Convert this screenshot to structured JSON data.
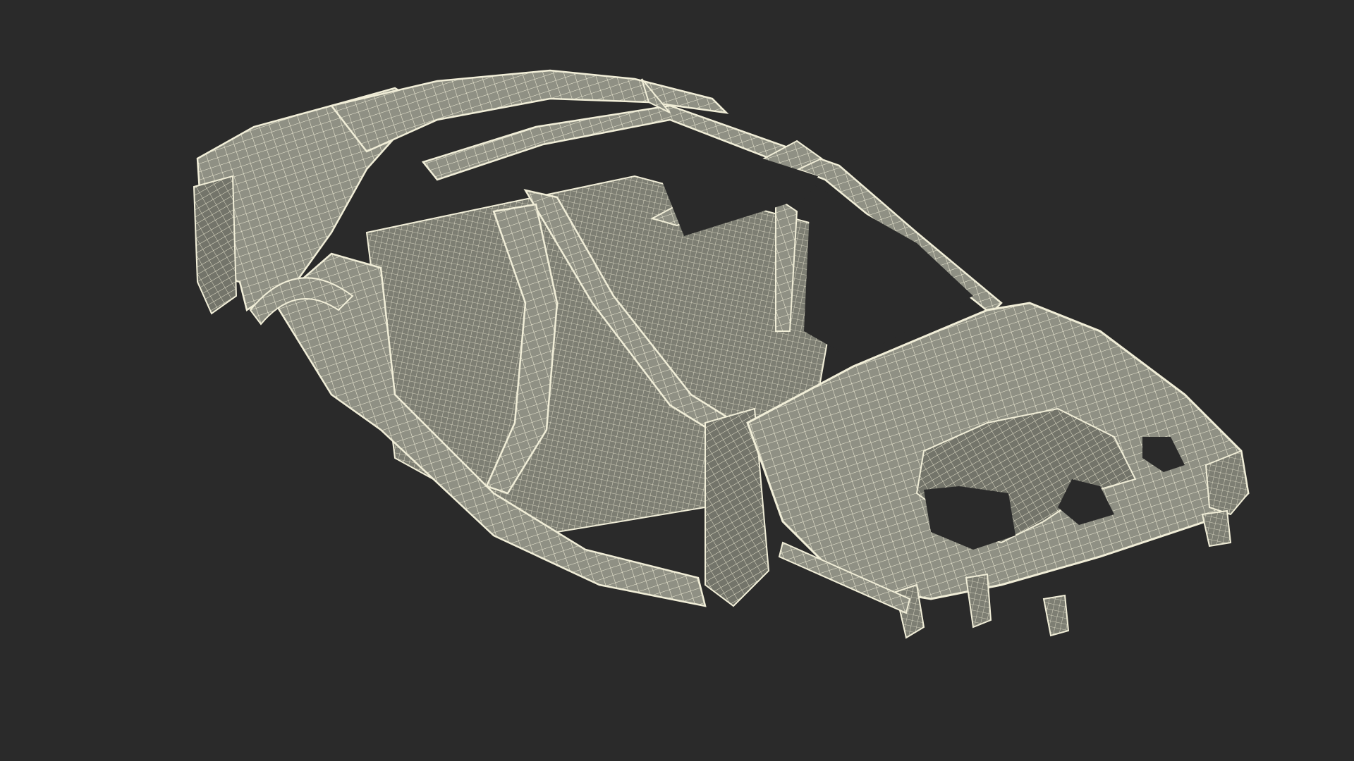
{
  "scene": {
    "background_color": "#2a2a2a",
    "subject": "car-body-in-white-wireframe",
    "panel_fill": "#8f9084",
    "panel_fill_dark": "#6f7066",
    "wire_color": "#f1eed8"
  }
}
